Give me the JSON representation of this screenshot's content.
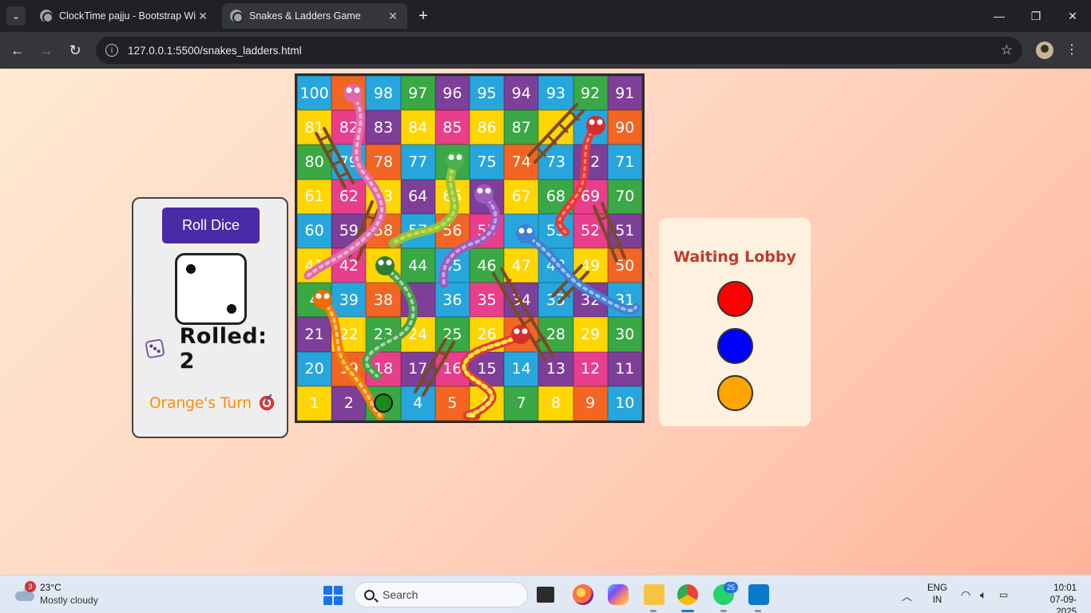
{
  "browser": {
    "tabs": [
      {
        "title": "ClockTime pajju - Bootstrap Wi",
        "active": false
      },
      {
        "title": "Snakes & Ladders Game",
        "active": true
      }
    ],
    "url": "127.0.0.1:5500/snakes_ladders.html"
  },
  "controls": {
    "roll_button": "Roll Dice",
    "die_value": 2,
    "rolled_label": "Rolled: 2",
    "turn_label": "Orange's Turn"
  },
  "board": {
    "cell_colors": {
      "yellow": "#ffd600",
      "purple": "#7e3f98",
      "green": "#39a845",
      "blue": "#27a6dd",
      "orange": "#f26522",
      "pink": "#e83e8c"
    },
    "rows": [
      {
        "cells": [
          {
            "n": "100",
            "c": "blue"
          },
          {
            "n": "",
            "c": "orange"
          },
          {
            "n": "98",
            "c": "blue"
          },
          {
            "n": "97",
            "c": "green"
          },
          {
            "n": "96",
            "c": "purple"
          },
          {
            "n": "95",
            "c": "blue"
          },
          {
            "n": "94",
            "c": "purple"
          },
          {
            "n": "93",
            "c": "blue"
          },
          {
            "n": "92",
            "c": "green"
          },
          {
            "n": "91",
            "c": "purple"
          }
        ]
      },
      {
        "cells": [
          {
            "n": "81",
            "c": "yellow"
          },
          {
            "n": "82",
            "c": "pink"
          },
          {
            "n": "83",
            "c": "purple"
          },
          {
            "n": "84",
            "c": "yellow"
          },
          {
            "n": "85",
            "c": "pink"
          },
          {
            "n": "86",
            "c": "yellow"
          },
          {
            "n": "87",
            "c": "green"
          },
          {
            "n": "",
            "c": "yellow"
          },
          {
            "n": "",
            "c": "blue"
          },
          {
            "n": "90",
            "c": "orange"
          }
        ]
      },
      {
        "cells": [
          {
            "n": "80",
            "c": "green"
          },
          {
            "n": "79",
            "c": "blue"
          },
          {
            "n": "78",
            "c": "orange"
          },
          {
            "n": "77",
            "c": "blue"
          },
          {
            "n": "",
            "c": "green"
          },
          {
            "n": "75",
            "c": "blue"
          },
          {
            "n": "74",
            "c": "orange"
          },
          {
            "n": "73",
            "c": "blue"
          },
          {
            "n": "72",
            "c": "purple"
          },
          {
            "n": "71",
            "c": "blue"
          }
        ]
      },
      {
        "cells": [
          {
            "n": "61",
            "c": "yellow"
          },
          {
            "n": "62",
            "c": "pink"
          },
          {
            "n": "63",
            "c": "yellow"
          },
          {
            "n": "64",
            "c": "purple"
          },
          {
            "n": "65",
            "c": "yellow"
          },
          {
            "n": "",
            "c": "purple"
          },
          {
            "n": "67",
            "c": "yellow"
          },
          {
            "n": "68",
            "c": "green"
          },
          {
            "n": "69",
            "c": "pink"
          },
          {
            "n": "70",
            "c": "green"
          }
        ]
      },
      {
        "cells": [
          {
            "n": "60",
            "c": "blue"
          },
          {
            "n": "59",
            "c": "purple"
          },
          {
            "n": "58",
            "c": "orange"
          },
          {
            "n": "57",
            "c": "blue"
          },
          {
            "n": "56",
            "c": "orange"
          },
          {
            "n": "55",
            "c": "pink"
          },
          {
            "n": "",
            "c": "blue"
          },
          {
            "n": "53",
            "c": "blue"
          },
          {
            "n": "52",
            "c": "pink"
          },
          {
            "n": "51",
            "c": "purple"
          }
        ]
      },
      {
        "cells": [
          {
            "n": "41",
            "c": "yellow"
          },
          {
            "n": "42",
            "c": "pink"
          },
          {
            "n": "",
            "c": "yellow"
          },
          {
            "n": "44",
            "c": "green"
          },
          {
            "n": "45",
            "c": "blue"
          },
          {
            "n": "46",
            "c": "green"
          },
          {
            "n": "47",
            "c": "yellow"
          },
          {
            "n": "48",
            "c": "blue"
          },
          {
            "n": "49",
            "c": "yellow"
          },
          {
            "n": "50",
            "c": "orange"
          }
        ]
      },
      {
        "cells": [
          {
            "n": "4",
            "c": "green"
          },
          {
            "n": "39",
            "c": "blue"
          },
          {
            "n": "38",
            "c": "orange"
          },
          {
            "n": "",
            "c": "purple"
          },
          {
            "n": "36",
            "c": "blue"
          },
          {
            "n": "35",
            "c": "pink"
          },
          {
            "n": "34",
            "c": "purple"
          },
          {
            "n": "33",
            "c": "blue"
          },
          {
            "n": "32",
            "c": "purple"
          },
          {
            "n": "31",
            "c": "blue"
          }
        ]
      },
      {
        "cells": [
          {
            "n": "21",
            "c": "purple"
          },
          {
            "n": "22",
            "c": "yellow"
          },
          {
            "n": "23",
            "c": "green"
          },
          {
            "n": "24",
            "c": "yellow"
          },
          {
            "n": "25",
            "c": "green"
          },
          {
            "n": "26",
            "c": "yellow"
          },
          {
            "n": "",
            "c": "orange"
          },
          {
            "n": "28",
            "c": "green"
          },
          {
            "n": "29",
            "c": "yellow"
          },
          {
            "n": "30",
            "c": "green"
          }
        ]
      },
      {
        "cells": [
          {
            "n": "20",
            "c": "blue"
          },
          {
            "n": "19",
            "c": "orange"
          },
          {
            "n": "18",
            "c": "pink"
          },
          {
            "n": "17",
            "c": "purple"
          },
          {
            "n": "16",
            "c": "pink"
          },
          {
            "n": "15",
            "c": "purple"
          },
          {
            "n": "14",
            "c": "blue"
          },
          {
            "n": "13",
            "c": "purple"
          },
          {
            "n": "12",
            "c": "pink"
          },
          {
            "n": "11",
            "c": "purple"
          }
        ]
      },
      {
        "cells": [
          {
            "n": "1",
            "c": "yellow"
          },
          {
            "n": "2",
            "c": "purple"
          },
          {
            "n": "",
            "c": "green"
          },
          {
            "n": "4",
            "c": "blue"
          },
          {
            "n": "5",
            "c": "orange"
          },
          {
            "n": "6",
            "c": "yellow"
          },
          {
            "n": "7",
            "c": "green"
          },
          {
            "n": "8",
            "c": "yellow"
          },
          {
            "n": "9",
            "c": "orange"
          },
          {
            "n": "10",
            "c": "blue"
          }
        ]
      }
    ],
    "tokens": [
      {
        "player": "green",
        "color": "#1b8a1b",
        "square": "3"
      }
    ]
  },
  "lobby": {
    "title": "Waiting Lobby",
    "players": [
      {
        "name": "red",
        "color": "#ff0000"
      },
      {
        "name": "blue",
        "color": "#0000ff"
      },
      {
        "name": "orange",
        "color": "#ffa500"
      }
    ]
  },
  "taskbar": {
    "weather": {
      "badge": "3",
      "temp": "23°C",
      "condition": "Mostly cloudy"
    },
    "search_placeholder": "Search",
    "whatsapp_badge": "25",
    "language": [
      "ENG",
      "IN"
    ],
    "time": "10:01",
    "date": "07-09-2025"
  }
}
